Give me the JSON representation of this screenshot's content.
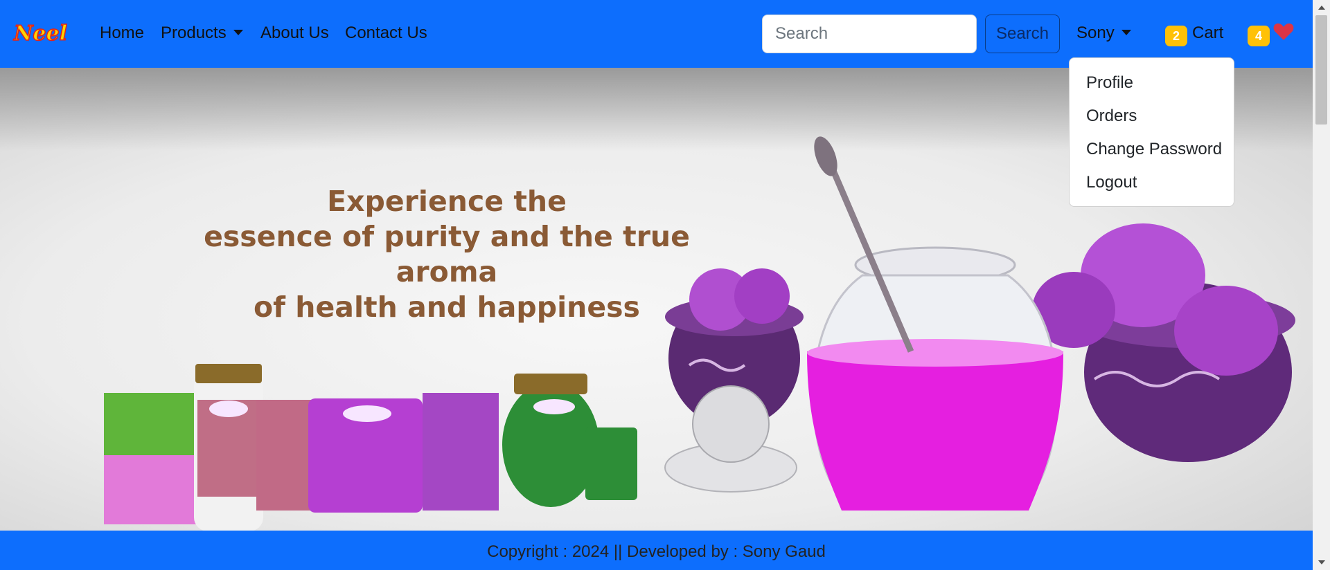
{
  "brand": {
    "logo_text": "Neel",
    "icon": "brand-logo"
  },
  "nav": {
    "home": "Home",
    "products": "Products",
    "about": "About Us",
    "contact": "Contact Us"
  },
  "search": {
    "placeholder": "Search",
    "button_label": "Search"
  },
  "user": {
    "name": "Sony"
  },
  "cart": {
    "count": "2",
    "label": "Cart"
  },
  "wishlist": {
    "count": "4",
    "icon": "heart-icon"
  },
  "user_menu": {
    "items": [
      "Profile",
      "Orders",
      "Change Password",
      "Logout"
    ]
  },
  "hero": {
    "headline_line1": "Experience the",
    "headline_line2": "essence of purity and the true aroma",
    "headline_line3": "of health and happiness"
  },
  "footer": {
    "text": "Copyright : 2024 || Developed by : Sony Gaud"
  },
  "colors": {
    "primary": "#0d6efd",
    "badge": "#ffc107",
    "heart": "#dc3545",
    "headline": "#8a5a35"
  }
}
